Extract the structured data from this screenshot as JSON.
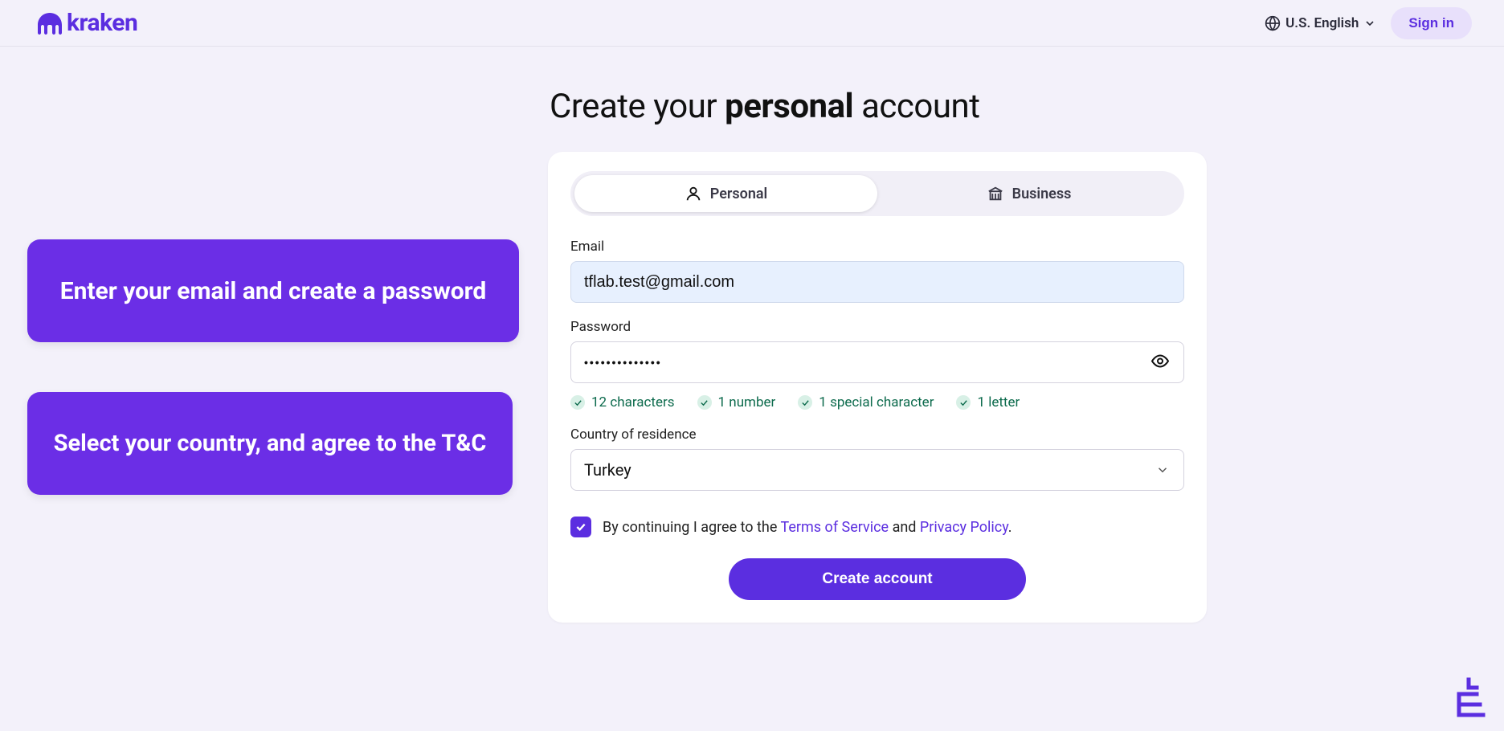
{
  "header": {
    "brand": "kraken",
    "language": "U.S. English",
    "signin": "Sign in"
  },
  "callouts": {
    "first": "Enter your email and create a password",
    "second": "Select your country, and agree to the T&C"
  },
  "title": {
    "prefix": "Create your ",
    "bold": "personal",
    "suffix": " account"
  },
  "tabs": {
    "personal": "Personal",
    "business": "Business"
  },
  "form": {
    "email_label": "Email",
    "email_value": "tflab.test@gmail.com",
    "password_label": "Password",
    "password_value": "••••••••••••••",
    "country_label": "Country of residence",
    "country_value": "Turkey",
    "password_rules": {
      "chars": "12 characters",
      "number": "1 number",
      "special": "1 special character",
      "letter": "1 letter"
    },
    "consent": {
      "prefix": "By continuing I agree to the ",
      "tos": "Terms of Service",
      "mid": " and ",
      "privacy": "Privacy Policy",
      "suffix": "."
    },
    "submit": "Create account"
  },
  "colors": {
    "accent": "#5b2ee0",
    "success": "#0d6b4d"
  }
}
